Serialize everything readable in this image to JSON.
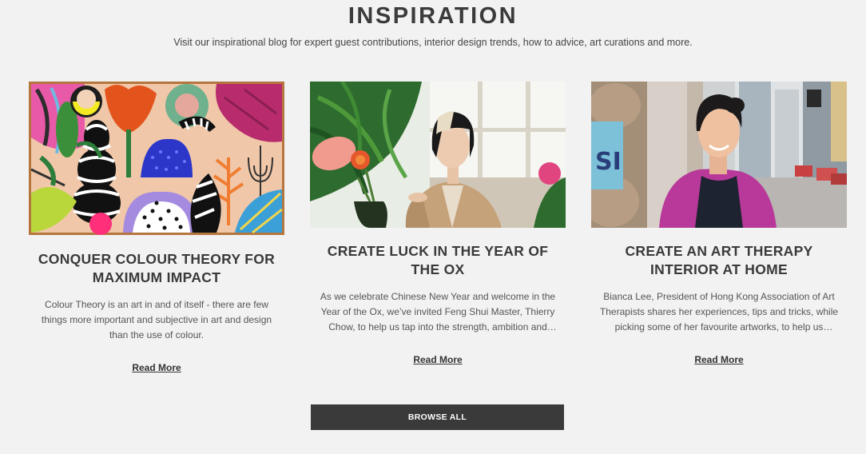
{
  "section": {
    "title": "INSPIRATION",
    "subtitle": "Visit our inspirational blog for expert guest contributions, interior design trends, how to advice, art curations and more."
  },
  "cards": [
    {
      "title": "CONQUER COLOUR THEORY FOR MAXIMUM IMPACT",
      "excerpt": "Colour Theory is an art in and of itself - there are few things more important and subjective in art and design than the use of colour.",
      "link": "Read More",
      "image": "colourful-abstract-painting"
    },
    {
      "title": "CREATE LUCK IN THE YEAR OF THE OX",
      "excerpt": "As we celebrate Chinese New Year and welcome in the Year of the Ox, we’ve invited Feng Shui Master, Thierry Chow, to help us tap into the strength, ambition and resilience of the Ox.",
      "link": "Read More",
      "image": "woman-arranging-flowers"
    },
    {
      "title": "CREATE AN ART THERAPY INTERIOR AT HOME",
      "excerpt": "Bianca Lee, President of Hong Kong Association of Art Therapists shares her experiences, tips and tricks, while picking some of her favourite artworks, to help us transition into a calmer home.",
      "link": "Read More",
      "image": "smiling-woman-city-street"
    }
  ],
  "browse_all": "BROWSE ALL",
  "colors": {
    "background": "#f2f2f2",
    "text": "#3a3a3a",
    "button": "#3a3a3a",
    "frame": "#b5763e"
  }
}
